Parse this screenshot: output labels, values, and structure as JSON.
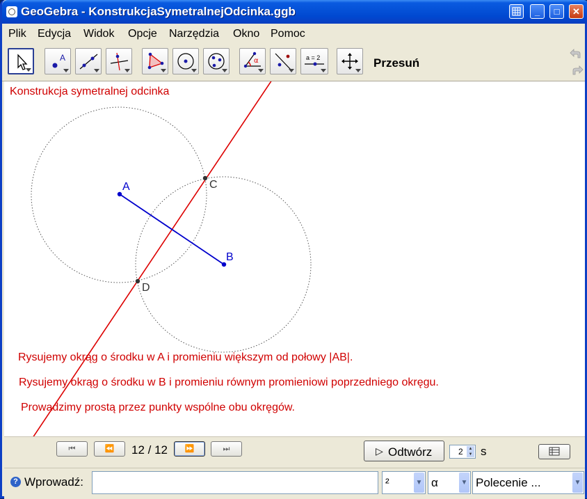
{
  "window": {
    "title": "GeoGebra - KonstrukcjaSymetralnejOdcinka.ggb",
    "controls": {
      "grid_icon": "grid-icon",
      "minimize": "_",
      "maximize": "□",
      "close": "✕"
    }
  },
  "menu": [
    "Plik",
    "Edycja",
    "Widok",
    "Opcje",
    "Narzędzia",
    "Okno",
    "Pomoc"
  ],
  "toolbar": {
    "tools": [
      "move-tool-icon",
      "point-tool-icon",
      "line-tool-icon",
      "perpendicular-tool-icon",
      "polygon-tool-icon",
      "circle-tool-icon",
      "conic-tool-icon",
      "angle-tool-icon",
      "reflect-tool-icon",
      "slider-tool-icon",
      "move-view-tool-icon"
    ],
    "slider_tool_text": "a = 2",
    "active_tool_name": "Przesuń"
  },
  "graphics": {
    "title": "Konstrukcja symetralnej odcinka",
    "points": {
      "A": "A",
      "B": "B",
      "C": "C",
      "D": "D"
    },
    "steps": [
      "Rysujemy okrąg o środku w A i promieniu większym od połowy |AB|.",
      "Rysujemy okrąg o środku w B i promieniu równym promieniowi poprzedniego okręgu.",
      "Prowadzimy prostą przez punkty wspólne obu okręgów."
    ],
    "colors": {
      "text": "#d00000",
      "segment": "#0000cc",
      "line": "#dd0000",
      "circle": "#555555"
    }
  },
  "navigation": {
    "first": "⏮",
    "prev": "⏪",
    "counter": "12 / 12",
    "next": "⏩",
    "last": "⏭",
    "play_icon": "▷",
    "play_label": "Odtwórz",
    "speed_value": "2",
    "speed_unit": "s"
  },
  "inputbar": {
    "label": "Wprowadź:",
    "value": "",
    "combo1": "²",
    "combo2": "α",
    "combo3": "Polecenie ..."
  }
}
